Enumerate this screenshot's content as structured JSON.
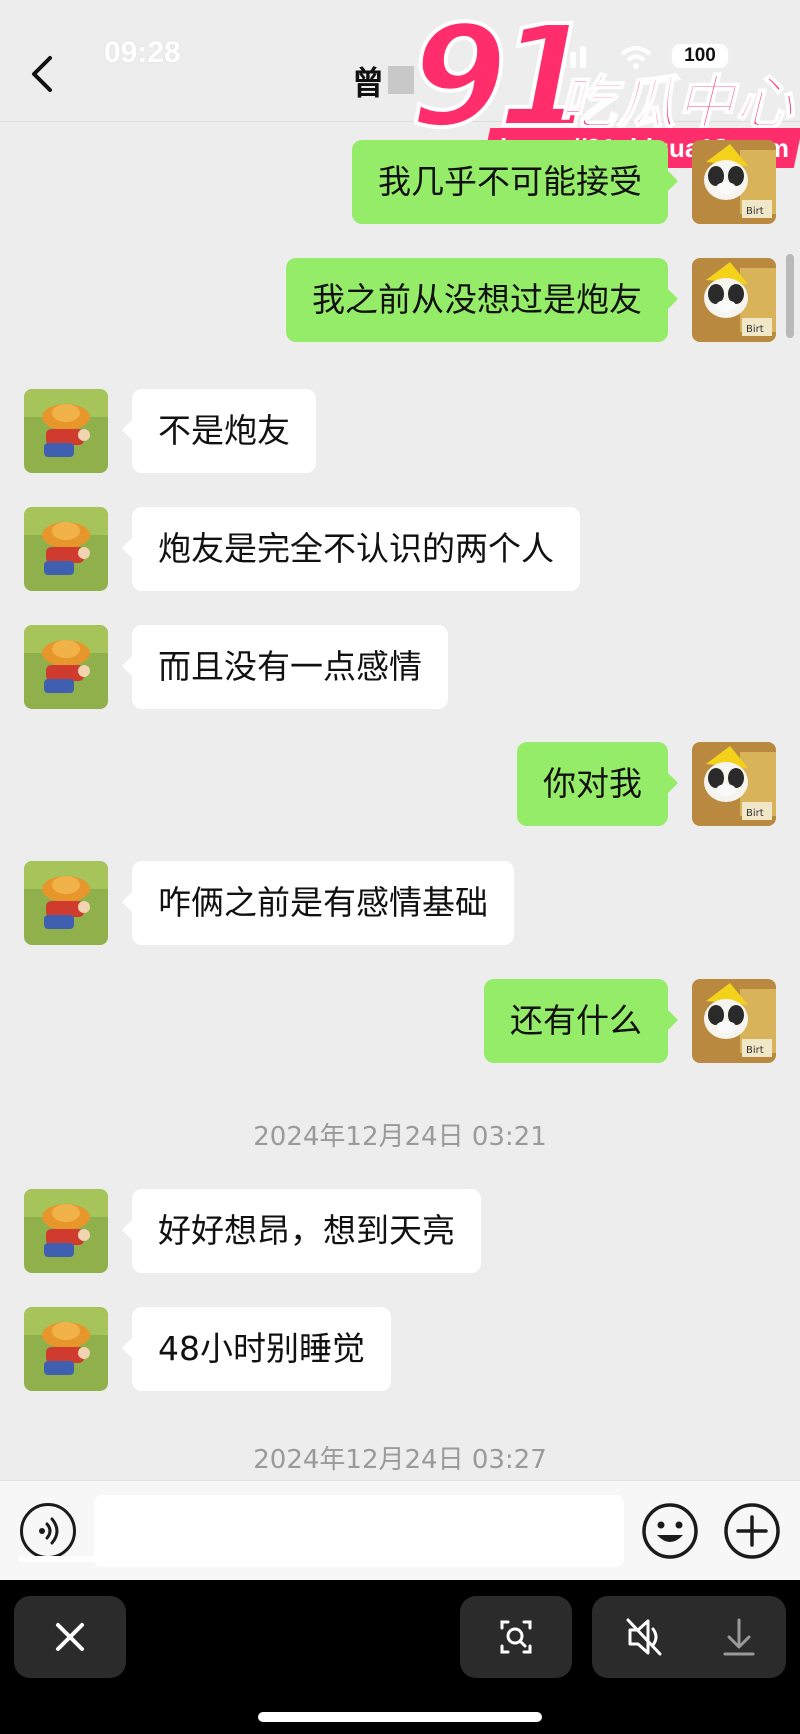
{
  "status": {
    "time": "09:28",
    "battery": "100"
  },
  "header": {
    "contact_name": "曾"
  },
  "watermark": {
    "number": "91",
    "text": "吃瓜中心",
    "url": "https://91chigua18.com"
  },
  "messages": [
    {
      "side": "right",
      "text": "我几乎不可能接受"
    },
    {
      "side": "right",
      "text": "我之前从没想过是炮友"
    },
    {
      "side": "left",
      "text": "不是炮友"
    },
    {
      "side": "left",
      "text": "炮友是完全不认识的两个人"
    },
    {
      "side": "left",
      "text": "而且没有一点感情"
    },
    {
      "side": "right",
      "text": "你对我"
    },
    {
      "side": "left",
      "text": "咋俩之前是有感情基础"
    },
    {
      "side": "right",
      "text": "还有什么"
    },
    {
      "type": "timestamp",
      "text": "2024年12月24日 03:21"
    },
    {
      "side": "left",
      "text": "好好想昂，想到天亮"
    },
    {
      "side": "left",
      "text": "48小时别睡觉"
    },
    {
      "type": "timestamp",
      "text": "2024年12月24日 03:27"
    }
  ],
  "input": {
    "placeholder": ""
  },
  "icons": {
    "back": "chevron-left-icon",
    "voice": "voice-icon",
    "emoji": "smiley-icon",
    "plus": "plus-icon",
    "close": "close-icon",
    "scan": "scan-icon",
    "mute": "speaker-muted-icon",
    "download": "download-icon"
  },
  "colors": {
    "background": "#ededed",
    "bubble_right": "#95ec69",
    "bubble_left": "#ffffff",
    "watermark": "#ff2d6b"
  }
}
